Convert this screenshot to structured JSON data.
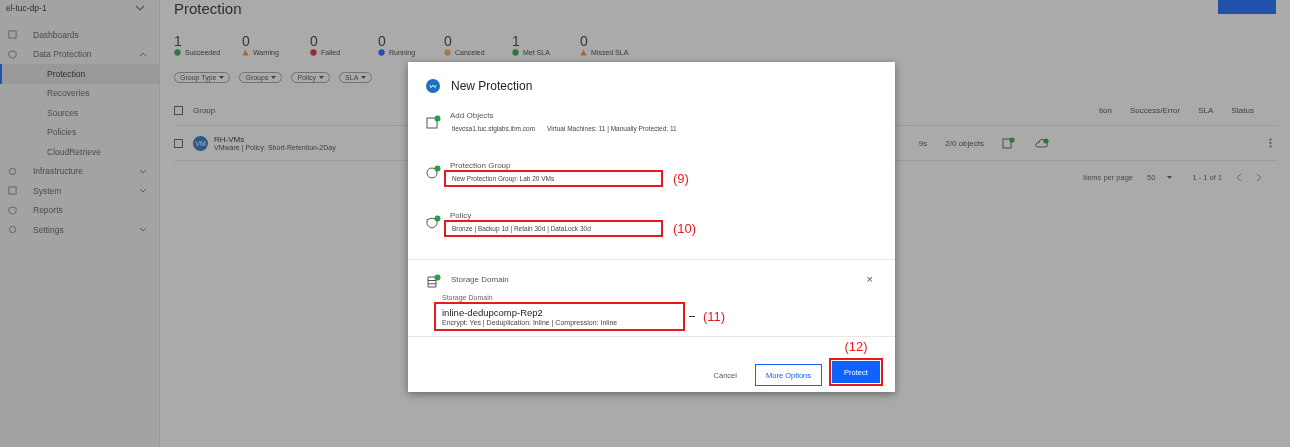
{
  "sidebar": {
    "cluster": "el-tuc-dp-1",
    "items": [
      {
        "label": "Dashboards",
        "kind": "link",
        "selected": false
      },
      {
        "label": "Data Protection",
        "kind": "section",
        "expanded": true,
        "selected": false,
        "children": [
          {
            "label": "Protection",
            "selected": true
          },
          {
            "label": "Recoveries",
            "selected": false
          },
          {
            "label": "Sources",
            "selected": false
          },
          {
            "label": "Policies",
            "selected": false
          },
          {
            "label": "CloudRetrieve",
            "selected": false
          }
        ]
      },
      {
        "label": "Infrastructure",
        "kind": "section",
        "expanded": false,
        "selected": false
      },
      {
        "label": "System",
        "kind": "section",
        "expanded": false,
        "selected": false
      },
      {
        "label": "Reports",
        "kind": "link",
        "selected": false
      },
      {
        "label": "Settings",
        "kind": "section",
        "expanded": false,
        "selected": false
      }
    ]
  },
  "page": {
    "title": "Protection",
    "stats": [
      {
        "value": "1",
        "label": "Succeeded",
        "kind": "success"
      },
      {
        "value": "0",
        "label": "Warning",
        "kind": "warning"
      },
      {
        "value": "0",
        "label": "Failed",
        "kind": "failed"
      },
      {
        "value": "0",
        "label": "Running",
        "kind": "running"
      },
      {
        "value": "0",
        "label": "Canceled",
        "kind": "canceled"
      },
      {
        "value": "1",
        "label": "Met SLA",
        "kind": "success"
      },
      {
        "value": "0",
        "label": "Missed SLA",
        "kind": "warning"
      }
    ],
    "filters": [
      "Group Type",
      "Groups",
      "Policy",
      "SLA"
    ],
    "table": {
      "all_selected": false,
      "columns_left": [
        "Group"
      ],
      "columns_right": [
        "tion",
        "Success/Error",
        "SLA",
        "Status"
      ],
      "rows": [
        {
          "selected": false,
          "avatar": "VM",
          "name": "RH-VMs",
          "detail": "VMware | Policy: Short-Retention-2Day",
          "cells": [
            "9s",
            "2/0 objects"
          ]
        }
      ]
    },
    "pagination": {
      "label": "Items per page",
      "per_page": "50",
      "range": "1 - 1 of 1"
    }
  },
  "dialog": {
    "title": "New Protection",
    "sections": [
      {
        "kind": "summary",
        "title": "Add Objects",
        "complete": true,
        "parts": [
          "tlevcsa1.tuc.stglabs.ibm.com",
          "Virtual Machines: 11 | Manually Protected: 11"
        ]
      },
      {
        "kind": "summary",
        "title": "Protection Group",
        "complete": true,
        "parts": [
          "New Protection Group: Lab 20 VMs"
        ],
        "callout": "(9)"
      },
      {
        "kind": "summary",
        "title": "Policy",
        "complete": true,
        "parts": [
          "Bronze | Backup 1d | Retain 30d | DataLock 30d"
        ],
        "callout": "(10)"
      },
      {
        "kind": "select",
        "title": "Storage Domain",
        "complete": true,
        "close": "×",
        "field_label": "Storage Domain",
        "value": "inline-dedupcomp-Rep2",
        "detail": "Encrypt: Yes | Deduplication: Inline | Compression: Inline",
        "callout": "(11)"
      }
    ],
    "buttons": [
      {
        "label": "Cancel",
        "kind": "ghost"
      },
      {
        "label": "More Options",
        "kind": "secondary"
      },
      {
        "label": "Protect",
        "kind": "primary",
        "callout": "(12)"
      }
    ]
  }
}
